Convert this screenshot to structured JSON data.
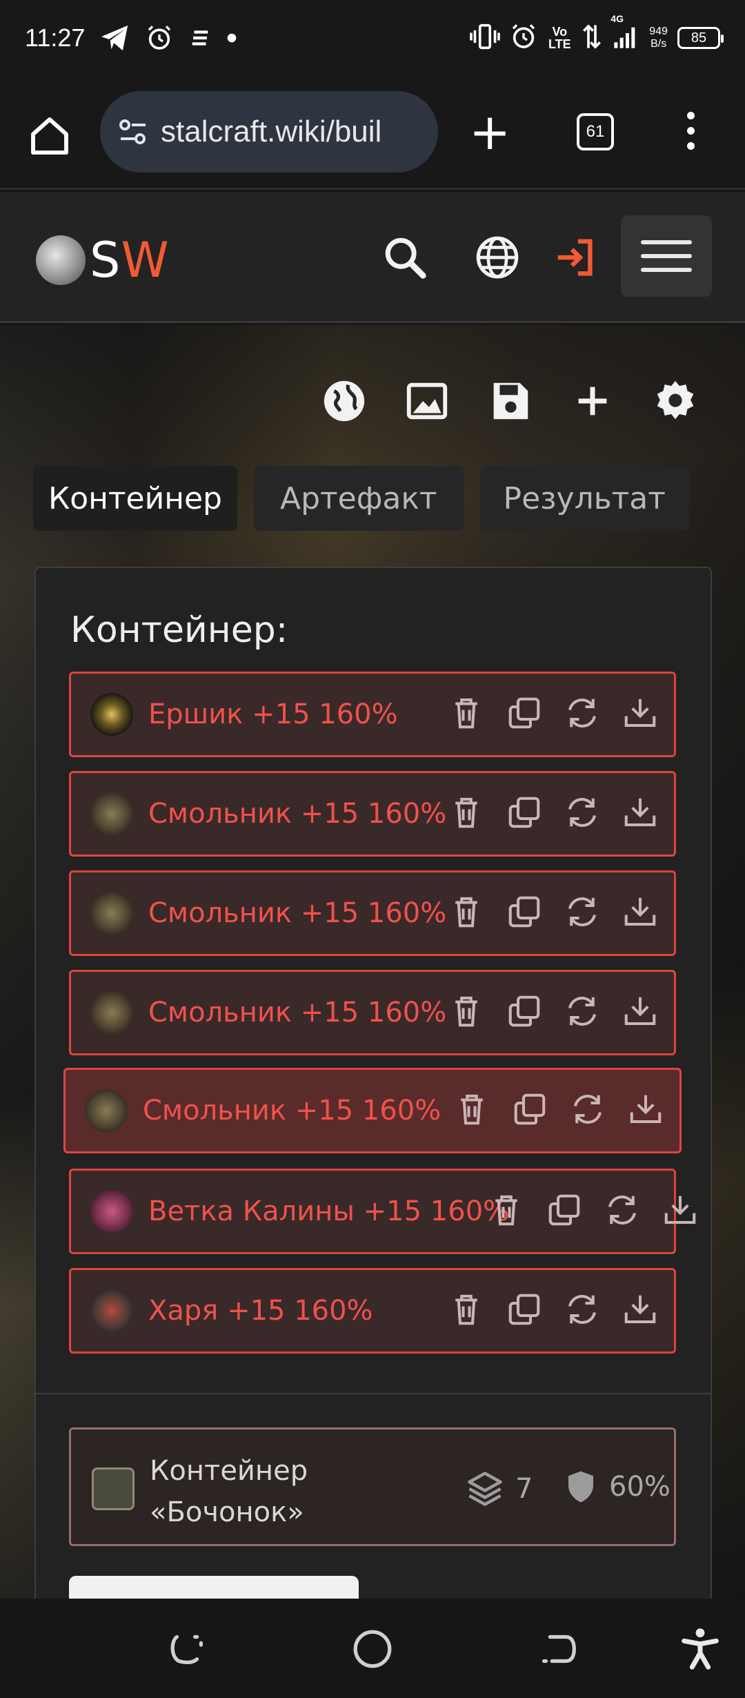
{
  "status": {
    "time": "11:27",
    "net_speed_value": "949",
    "net_speed_unit": "B/s",
    "battery": "85",
    "network_label": "4G",
    "volte_label": "Vo LTE"
  },
  "browser": {
    "url": "stalcraft.wiki/buil",
    "tab_count": "61"
  },
  "site": {
    "logo_text_a": "S",
    "logo_text_b": "W"
  },
  "tabs": [
    {
      "label": "Контейнер",
      "active": true
    },
    {
      "label": "Артефакт",
      "active": false
    },
    {
      "label": "Результат",
      "active": false
    }
  ],
  "panel": {
    "title": "Контейнер:",
    "artifacts": [
      {
        "name": "Ершик +15 160%",
        "icon": "ershik-artifact-icon"
      },
      {
        "name": "Смольник +15 160%",
        "icon": "smolnik-artifact-icon"
      },
      {
        "name": "Смольник +15 160%",
        "icon": "smolnik-artifact-icon"
      },
      {
        "name": "Смольник +15 160%",
        "icon": "smolnik-artifact-icon"
      },
      {
        "name": "Смольник +15 160%",
        "icon": "smolnik-artifact-icon",
        "selected": true
      },
      {
        "name": "Ветка Калины +15 160%",
        "icon": "vetka-kaliny-artifact-icon"
      },
      {
        "name": "Харя +15 160%",
        "icon": "harya-artifact-icon"
      }
    ],
    "container": {
      "name": "Контейнер «Бочонок»",
      "slots": "7",
      "protection": "60%"
    }
  },
  "colors": {
    "accent": "#f25a34",
    "artifact_border": "#e0433f",
    "artifact_text": "#f0514c"
  }
}
